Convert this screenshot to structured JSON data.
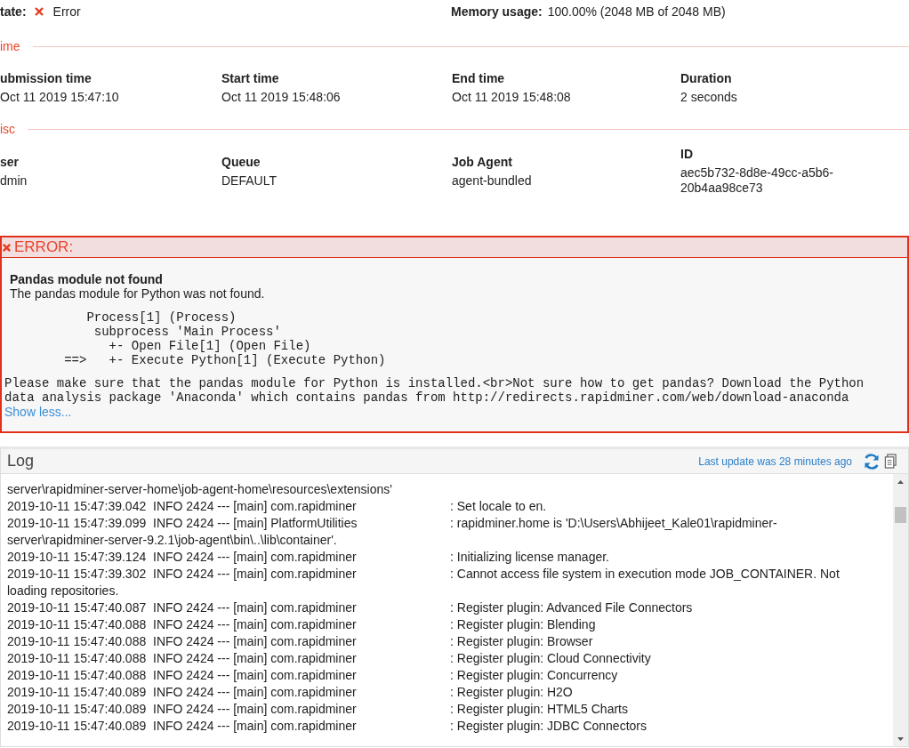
{
  "summary": {
    "state_label": "tate:",
    "state_value": "Error",
    "memory_label": "Memory usage:",
    "memory_value": "100.00% (2048 MB of 2048 MB)"
  },
  "sections": [
    {
      "title": "ime",
      "fields": [
        {
          "label": "ubmission time",
          "value": "Oct 11 2019 15:47:10"
        },
        {
          "label": "Start time",
          "value": "Oct 11 2019 15:48:06"
        },
        {
          "label": "End time",
          "value": "Oct 11 2019 15:48:08"
        },
        {
          "label": "Duration",
          "value": "2 seconds"
        }
      ]
    },
    {
      "title": "isc",
      "fields": [
        {
          "label": "ser",
          "value": "dmin"
        },
        {
          "label": "Queue",
          "value": "DEFAULT"
        },
        {
          "label": "Job Agent",
          "value": "agent-bundled"
        },
        {
          "label": "ID",
          "value": "aec5b732-8d8e-49cc-a5b6-20b4aa98ce73"
        }
      ]
    }
  ],
  "error": {
    "title": "ERROR:",
    "heading": "Pandas module not found",
    "description": "The pandas module for Python was not found.",
    "trace": [
      "           Process[1] (Process)",
      "            subprocess 'Main Process'",
      "              +- Open File[1] (Open File)",
      "        ==>   +- Execute Python[1] (Execute Python)"
    ],
    "details": "Please make sure that the pandas module for Python is installed.<br>Not sure how to get pandas? Download the Python data analysis package 'Anaconda' which contains pandas from http://redirects.rapidminer.com/web/download-anaconda",
    "toggle": "Show less..."
  },
  "log": {
    "title": "Log",
    "last_update": "Last update was 28 minutes ago",
    "lines": [
      {
        "kind": "continuation",
        "text": "server\\rapidminer-server-home\\job-agent-home\\resources\\extensions'"
      },
      {
        "kind": "entry",
        "prefix": "2019-10-11 15:47:39.042  INFO 2424 --- [main] com.rapidminer",
        "message": ": Set locale to en."
      },
      {
        "kind": "entry",
        "prefix": "2019-10-11 15:47:39.099  INFO 2424 --- [main] PlatformUtilities",
        "message": ": rapidminer.home is 'D:\\Users\\Abhijeet_Kale01\\rapidminer-server\\rapidminer-server-9.2.1\\job-agent\\bin\\..\\lib\\container'."
      },
      {
        "kind": "entry",
        "prefix": "2019-10-11 15:47:39.124  INFO 2424 --- [main] com.rapidminer",
        "message": ": Initializing license manager."
      },
      {
        "kind": "entry",
        "prefix": "2019-10-11 15:47:39.302  INFO 2424 --- [main] com.rapidminer",
        "message": ": Cannot access file system in execution mode JOB_CONTAINER. Not loading repositories."
      },
      {
        "kind": "entry",
        "prefix": "2019-10-11 15:47:40.087  INFO 2424 --- [main] com.rapidminer",
        "message": ": Register plugin: Advanced File Connectors"
      },
      {
        "kind": "entry",
        "prefix": "2019-10-11 15:47:40.088  INFO 2424 --- [main] com.rapidminer",
        "message": ": Register plugin: Blending"
      },
      {
        "kind": "entry",
        "prefix": "2019-10-11 15:47:40.088  INFO 2424 --- [main] com.rapidminer",
        "message": ": Register plugin: Browser"
      },
      {
        "kind": "entry",
        "prefix": "2019-10-11 15:47:40.088  INFO 2424 --- [main] com.rapidminer",
        "message": ": Register plugin: Cloud Connectivity"
      },
      {
        "kind": "entry",
        "prefix": "2019-10-11 15:47:40.088  INFO 2424 --- [main] com.rapidminer",
        "message": ": Register plugin: Concurrency"
      },
      {
        "kind": "entry",
        "prefix": "2019-10-11 15:47:40.089  INFO 2424 --- [main] com.rapidminer",
        "message": ": Register plugin: H2O"
      },
      {
        "kind": "entry",
        "prefix": "2019-10-11 15:47:40.089  INFO 2424 --- [main] com.rapidminer",
        "message": ": Register plugin: HTML5 Charts"
      },
      {
        "kind": "entry",
        "prefix": "2019-10-11 15:47:40.089  INFO 2424 --- [main] com.rapidminer",
        "message": ": Register plugin: JDBC Connectors"
      }
    ]
  }
}
